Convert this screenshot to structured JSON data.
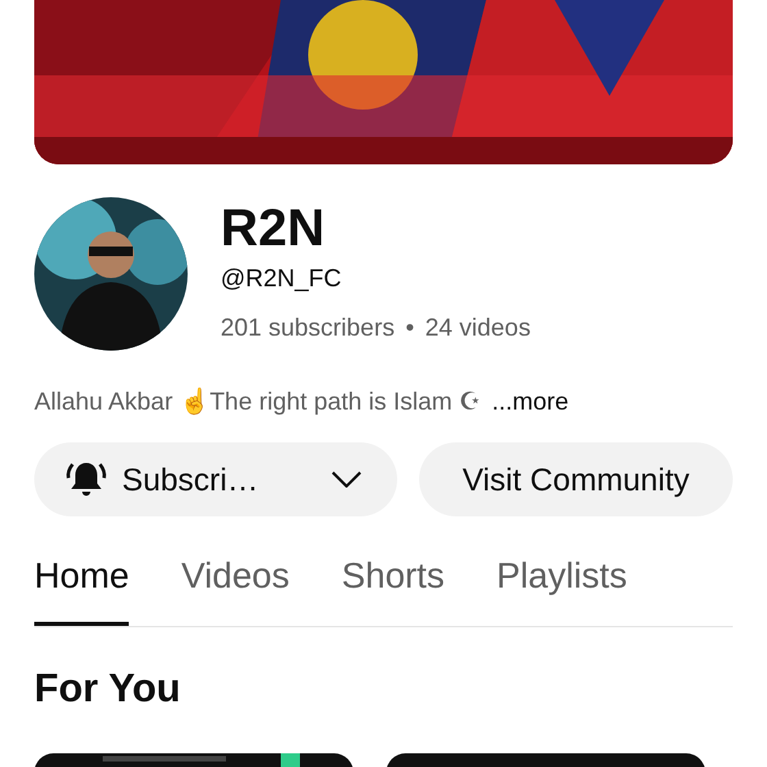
{
  "channel": {
    "name": "R2N",
    "handle": "@R2N_FC",
    "subscribers": "201 subscribers",
    "separator": "•",
    "videos": "24 videos"
  },
  "description": {
    "text": "Allahu Akbar ☝The right path is Islam ☪",
    "more": "...more"
  },
  "buttons": [
    {
      "kind": "subscribe",
      "label": "Subscri…"
    },
    {
      "kind": "plain",
      "label": "Visit Community"
    }
  ],
  "tabs": [
    {
      "label": "Home",
      "selected": true
    },
    {
      "label": "Videos",
      "selected": false
    },
    {
      "label": "Shorts",
      "selected": false
    },
    {
      "label": "Playlists",
      "selected": false
    }
  ],
  "section": {
    "title": "For You"
  }
}
